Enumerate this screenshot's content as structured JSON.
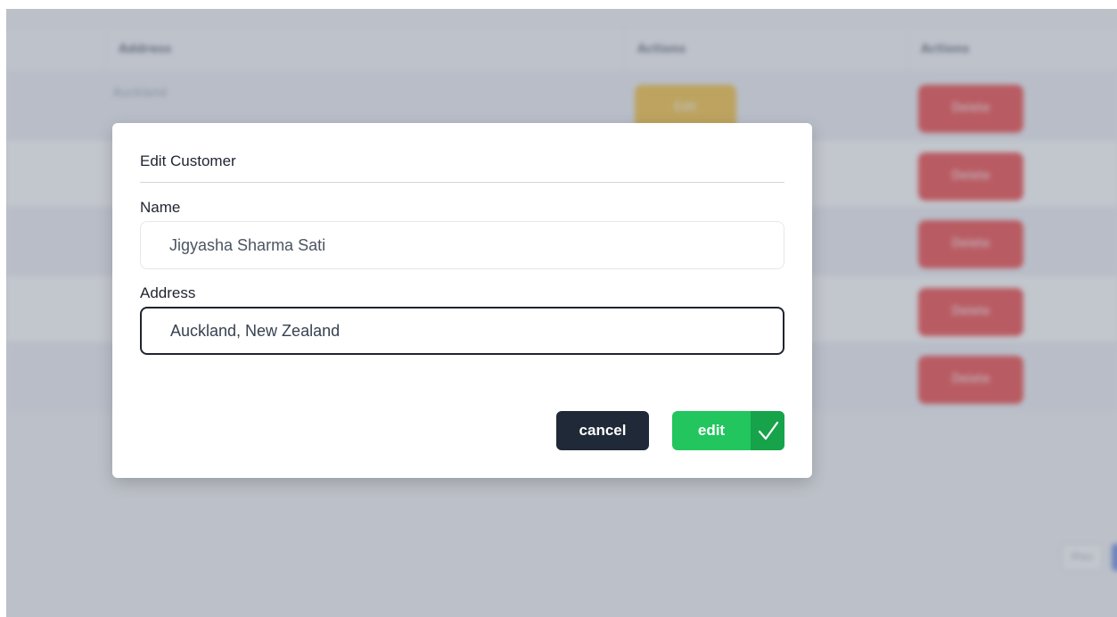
{
  "background_table": {
    "headers": [
      "Address",
      "Actions",
      "Actions"
    ],
    "first_row_address": "Auckland",
    "edit_button_label": "Edit",
    "delete_button_label": "Delete",
    "pager_label": "Prev"
  },
  "modal": {
    "title": "Edit Customer",
    "name_label": "Name",
    "name_value": "Jigyasha Sharma Sati",
    "address_label": "Address",
    "address_value": "Auckland, New Zealand",
    "cancel_label": "cancel",
    "edit_label": "edit",
    "edit_icon": "checkmark-icon"
  },
  "colors": {
    "primary_dark": "#1f2937",
    "success": "#22c55e",
    "success_dark": "#16a34a"
  }
}
